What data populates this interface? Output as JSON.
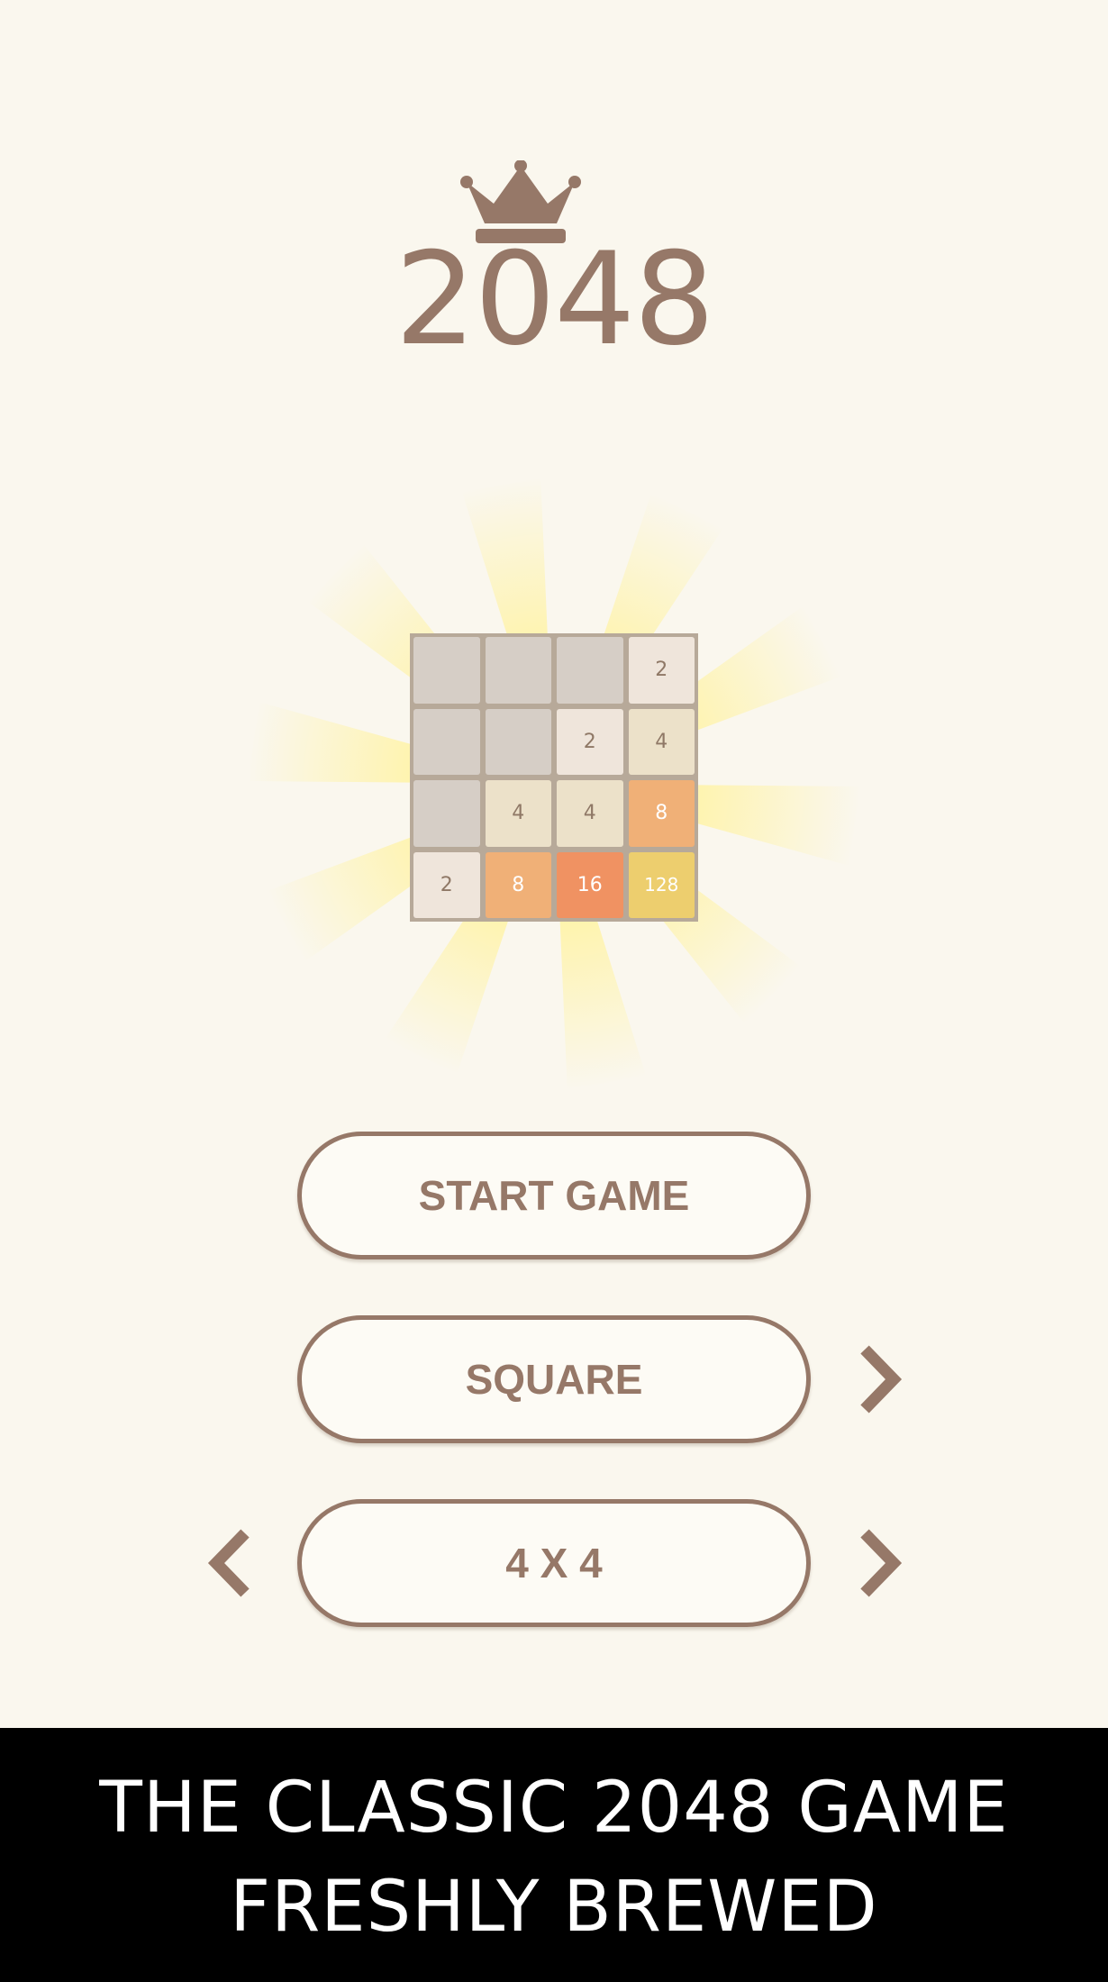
{
  "logo": {
    "icon": "crown-icon",
    "title": "2048"
  },
  "board_preview": {
    "rows": [
      [
        "",
        "",
        "",
        "2"
      ],
      [
        "",
        "",
        "2",
        "4"
      ],
      [
        "",
        "4",
        "4",
        "8"
      ],
      [
        "2",
        "8",
        "16",
        "128"
      ]
    ]
  },
  "menu": {
    "start_label": "START GAME",
    "mode_label": "SQUARE",
    "size_label": "4 X 4",
    "mode_next_icon": "chevron-right-icon",
    "size_prev_icon": "chevron-left-icon",
    "size_next_icon": "chevron-right-icon"
  },
  "banner": {
    "line1": "THE CLASSIC 2048 GAME",
    "line2": "FRESHLY BREWED"
  },
  "colors": {
    "background": "#faf7ee",
    "accent_brown": "#967868",
    "board": "#b7a999",
    "tile_empty": "#d6cec6",
    "tile_2": "#efe5db",
    "tile_4": "#ece1c9",
    "tile_8": "#f0b077",
    "tile_16": "#f09262",
    "tile_128": "#edce6e",
    "glow": "#fff3a6",
    "banner_bg": "#000000"
  }
}
